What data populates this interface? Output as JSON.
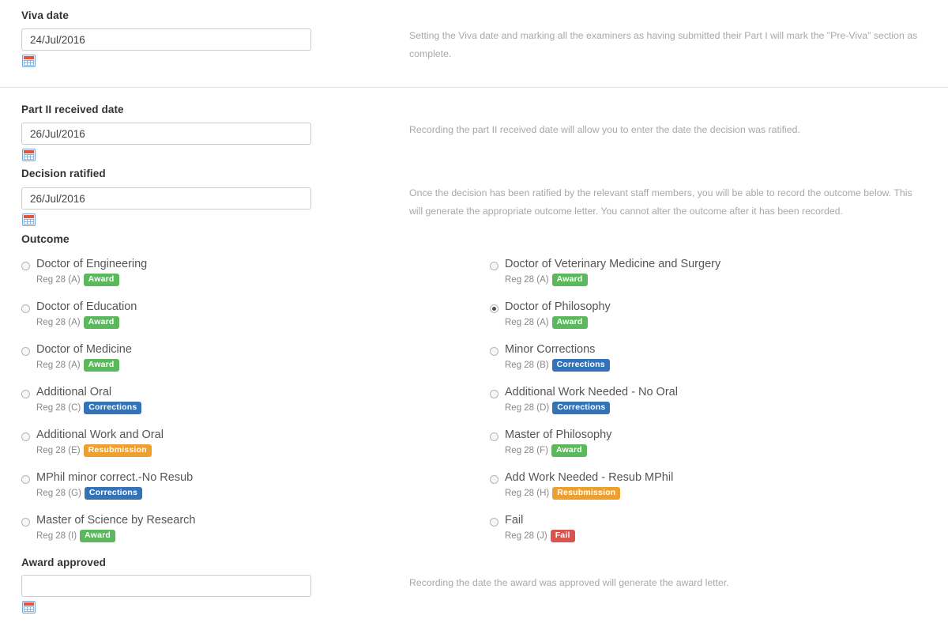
{
  "sections": {
    "viva": {
      "label": "Viva date",
      "value": "24/Jul/2016",
      "placeholder": "",
      "help": "Setting the Viva date and marking all the examiners as having submitted their Part I will mark the \"Pre-Viva\" section as complete."
    },
    "part2": {
      "label": "Part II received date",
      "value": "26/Jul/2016",
      "placeholder": "",
      "help": "Recording the part II received date will allow you to enter the date the decision was ratified."
    },
    "ratified": {
      "label": "Decision ratified",
      "value": "26/Jul/2016",
      "placeholder": "",
      "help": "Once the decision has been ratified by the relevant staff members, you will be able to record the outcome below. This will generate the appropriate outcome letter. You cannot alter the outcome after it has been recorded."
    },
    "award_approved": {
      "label": "Award approved",
      "value": "",
      "placeholder": "",
      "help": "Recording the date the award was approved will generate the award letter."
    }
  },
  "outcome": {
    "title": "Outcome",
    "left": [
      {
        "label": "Doctor of Engineering",
        "reg": "Reg 28 (A)",
        "badge": "Award",
        "badge_type": "award",
        "selected": false
      },
      {
        "label": "Doctor of Education",
        "reg": "Reg 28 (A)",
        "badge": "Award",
        "badge_type": "award",
        "selected": false
      },
      {
        "label": "Doctor of Medicine",
        "reg": "Reg 28 (A)",
        "badge": "Award",
        "badge_type": "award",
        "selected": false
      },
      {
        "label": "Additional Oral",
        "reg": "Reg 28 (C)",
        "badge": "Corrections",
        "badge_type": "corrections",
        "selected": false
      },
      {
        "label": "Additional Work and Oral",
        "reg": "Reg 28 (E)",
        "badge": "Resubmission",
        "badge_type": "resub",
        "selected": false
      },
      {
        "label": "MPhil minor correct.-No Resub",
        "reg": "Reg 28 (G)",
        "badge": "Corrections",
        "badge_type": "corrections",
        "selected": false
      },
      {
        "label": "Master of Science by Research",
        "reg": "Reg 28 (I)",
        "badge": "Award",
        "badge_type": "award",
        "selected": false
      }
    ],
    "right": [
      {
        "label": "Doctor of Veterinary Medicine and Surgery",
        "reg": "Reg 28 (A)",
        "badge": "Award",
        "badge_type": "award",
        "selected": false
      },
      {
        "label": "Doctor of Philosophy",
        "reg": "Reg 28 (A)",
        "badge": "Award",
        "badge_type": "award",
        "selected": true
      },
      {
        "label": "Minor Corrections",
        "reg": "Reg 28 (B)",
        "badge": "Corrections",
        "badge_type": "corrections",
        "selected": false
      },
      {
        "label": "Additional Work Needed - No Oral",
        "reg": "Reg 28 (D)",
        "badge": "Corrections",
        "badge_type": "corrections",
        "selected": false
      },
      {
        "label": "Master of Philosophy",
        "reg": "Reg 28 (F)",
        "badge": "Award",
        "badge_type": "award",
        "selected": false
      },
      {
        "label": "Add Work Needed - Resub MPhil",
        "reg": "Reg 28 (H)",
        "badge": "Resubmission",
        "badge_type": "resub",
        "selected": false
      },
      {
        "label": "Fail",
        "reg": "Reg 28 (J)",
        "badge": "Fail",
        "badge_type": "fail",
        "selected": false
      }
    ]
  },
  "icons": {
    "calendar": "calendar-icon"
  },
  "colors": {
    "award": "#5cb85c",
    "corrections": "#3573b9",
    "resubmission": "#eda030",
    "fail": "#d9534f",
    "border": "#cccccc",
    "help_text": "#a8a8a8"
  }
}
